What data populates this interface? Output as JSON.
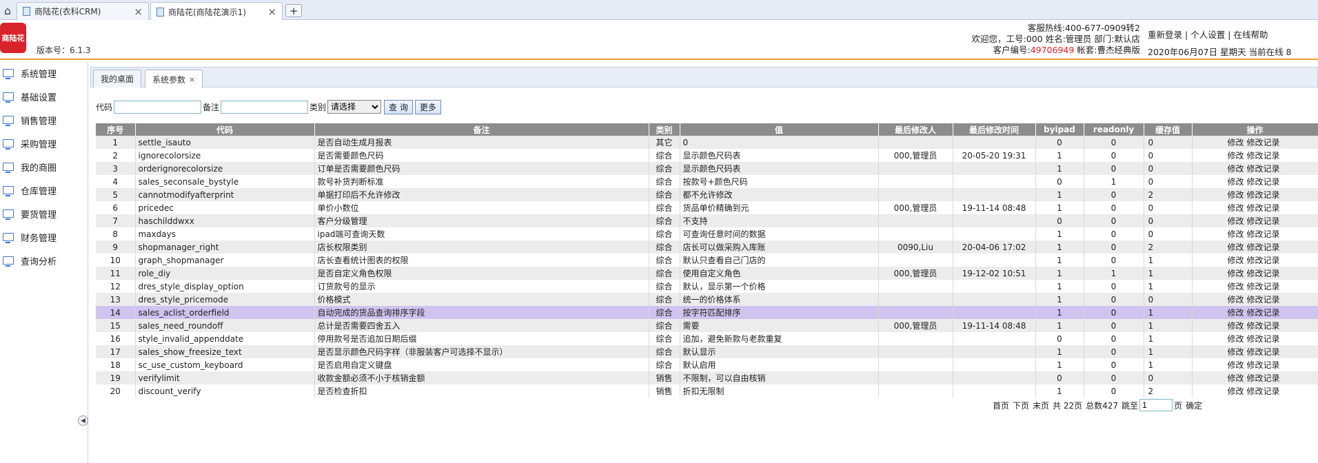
{
  "browser": {
    "tabs": [
      {
        "label": "商陆花(衣科CRM)"
      },
      {
        "label": "商陆花(商陆花演示1)"
      }
    ]
  },
  "header": {
    "logo_text": "商陆花",
    "version": "版本号：6.1.3",
    "hotline": "客服热线:400-677-0909转2",
    "welcome": "欢迎您，工号:000 姓名:管理员 部门:默认店",
    "customer_label": "客户编号:",
    "customer_id": "49706949",
    "account": " 帐套:曹杰经典版",
    "links": {
      "relogin": "重新登录",
      "personal": "个人设置",
      "help": "在线帮助"
    },
    "date_line": "2020年06月07日 星期天 当前在线 8"
  },
  "sidebar": {
    "items": [
      "系统管理",
      "基础设置",
      "销售管理",
      "采购管理",
      "我的商圈",
      "仓库管理",
      "要货管理",
      "财务管理",
      "查询分析"
    ]
  },
  "inner_tabs": [
    {
      "label": "我的桌面"
    },
    {
      "label": "系统参数"
    }
  ],
  "search": {
    "code_label": "代码",
    "code_value": "",
    "remark_label": "备注",
    "remark_value": "",
    "category_label": "类别",
    "category_selected": "请选择",
    "query_button": "查 询",
    "more_button": "更多"
  },
  "table": {
    "columns": [
      "序号",
      "代码",
      "备注",
      "类别",
      "值",
      "最后修改人",
      "最后修改时间",
      "byipad",
      "readonly",
      "缓存值",
      "操作"
    ],
    "op_edit": "修改",
    "op_log": "修改记录",
    "selected_index": 13,
    "rows": [
      [
        "1",
        "settle_isauto",
        "是否自动生成月报表",
        "其它",
        "0",
        "",
        "",
        "0",
        "0",
        "0"
      ],
      [
        "2",
        "ignorecolorsize",
        "是否需要颜色尺码",
        "综合",
        "显示颜色尺码表",
        "000,管理员",
        "20-05-20 19:31",
        "1",
        "0",
        "0"
      ],
      [
        "3",
        "orderignorecolorsize",
        "订单是否需要颜色尺码",
        "综合",
        "显示颜色尺码表",
        "",
        "",
        "1",
        "0",
        "0"
      ],
      [
        "4",
        "sales_seconsale_bystyle",
        "款号补货判断标准",
        "综合",
        "按款号+颜色尺码",
        "",
        "",
        "0",
        "1",
        "0"
      ],
      [
        "5",
        "cannotmodifyafterprint",
        "单据打印后不允许修改",
        "综合",
        "都不允许修改",
        "",
        "",
        "1",
        "0",
        "2"
      ],
      [
        "6",
        "pricedec",
        "单价小数位",
        "综合",
        "货品单价精确到元",
        "000,管理员",
        "19-11-14 08:48",
        "1",
        "0",
        "0"
      ],
      [
        "7",
        "haschilddwxx",
        "客户分级管理",
        "综合",
        "不支持",
        "",
        "",
        "0",
        "0",
        "0"
      ],
      [
        "8",
        "maxdays",
        "ipad端可查询天数",
        "综合",
        "可查询任意时间的数据",
        "",
        "",
        "1",
        "0",
        "0"
      ],
      [
        "9",
        "shopmanager_right",
        "店长权限类别",
        "综合",
        "店长可以做采购入库账",
        "0090,Liu",
        "20-04-06 17:02",
        "1",
        "0",
        "2"
      ],
      [
        "10",
        "graph_shopmanager",
        "店长查看统计图表的权限",
        "综合",
        "默认只查看自己门店的",
        "",
        "",
        "1",
        "0",
        "1"
      ],
      [
        "11",
        "role_diy",
        "是否自定义角色权限",
        "综合",
        "使用自定义角色",
        "000,管理员",
        "19-12-02 10:51",
        "1",
        "1",
        "1"
      ],
      [
        "12",
        "dres_style_display_option",
        "订货款号的显示",
        "综合",
        "默认，显示第一个价格",
        "",
        "",
        "1",
        "0",
        "1"
      ],
      [
        "13",
        "dres_style_pricemode",
        "价格模式",
        "综合",
        "统一的价格体系",
        "",
        "",
        "1",
        "0",
        "0"
      ],
      [
        "14",
        "sales_aclist_orderfield",
        "自动完成的货品查询排序字段",
        "综合",
        "按字符匹配排序",
        "",
        "",
        "1",
        "0",
        "1"
      ],
      [
        "15",
        "sales_need_roundoff",
        "总计是否需要四舍五入",
        "综合",
        "需要",
        "000,管理员",
        "19-11-14 08:48",
        "1",
        "0",
        "1"
      ],
      [
        "16",
        "style_invalid_appenddate",
        "停用款号是否追加日期后缀",
        "综合",
        "追加，避免新款与老款重复",
        "",
        "",
        "0",
        "0",
        "1"
      ],
      [
        "17",
        "sales_show_freesize_text",
        "是否显示颜色尺码字样（非服装客户可选择不显示）",
        "综合",
        "默认显示",
        "",
        "",
        "1",
        "0",
        "1"
      ],
      [
        "18",
        "sc_use_custom_keyboard",
        "是否启用自定义键盘",
        "综合",
        "默认启用",
        "",
        "",
        "1",
        "0",
        "1"
      ],
      [
        "19",
        "verifylimit",
        "收款金额必须不小于核销金额",
        "销售",
        "不限制，可以自由核销",
        "",
        "",
        "0",
        "0",
        "0"
      ],
      [
        "20",
        "discount_verify",
        "是否检查折扣",
        "销售",
        "折扣无限制",
        "",
        "",
        "1",
        "0",
        "2"
      ]
    ]
  },
  "pager": {
    "first": "首页",
    "next": "下页",
    "last": "末页",
    "total_pages": "共 22页",
    "total_count": "总数427",
    "jump_label": "跳至",
    "jump_value": "1",
    "page_unit": "页",
    "confirm": "确定"
  }
}
